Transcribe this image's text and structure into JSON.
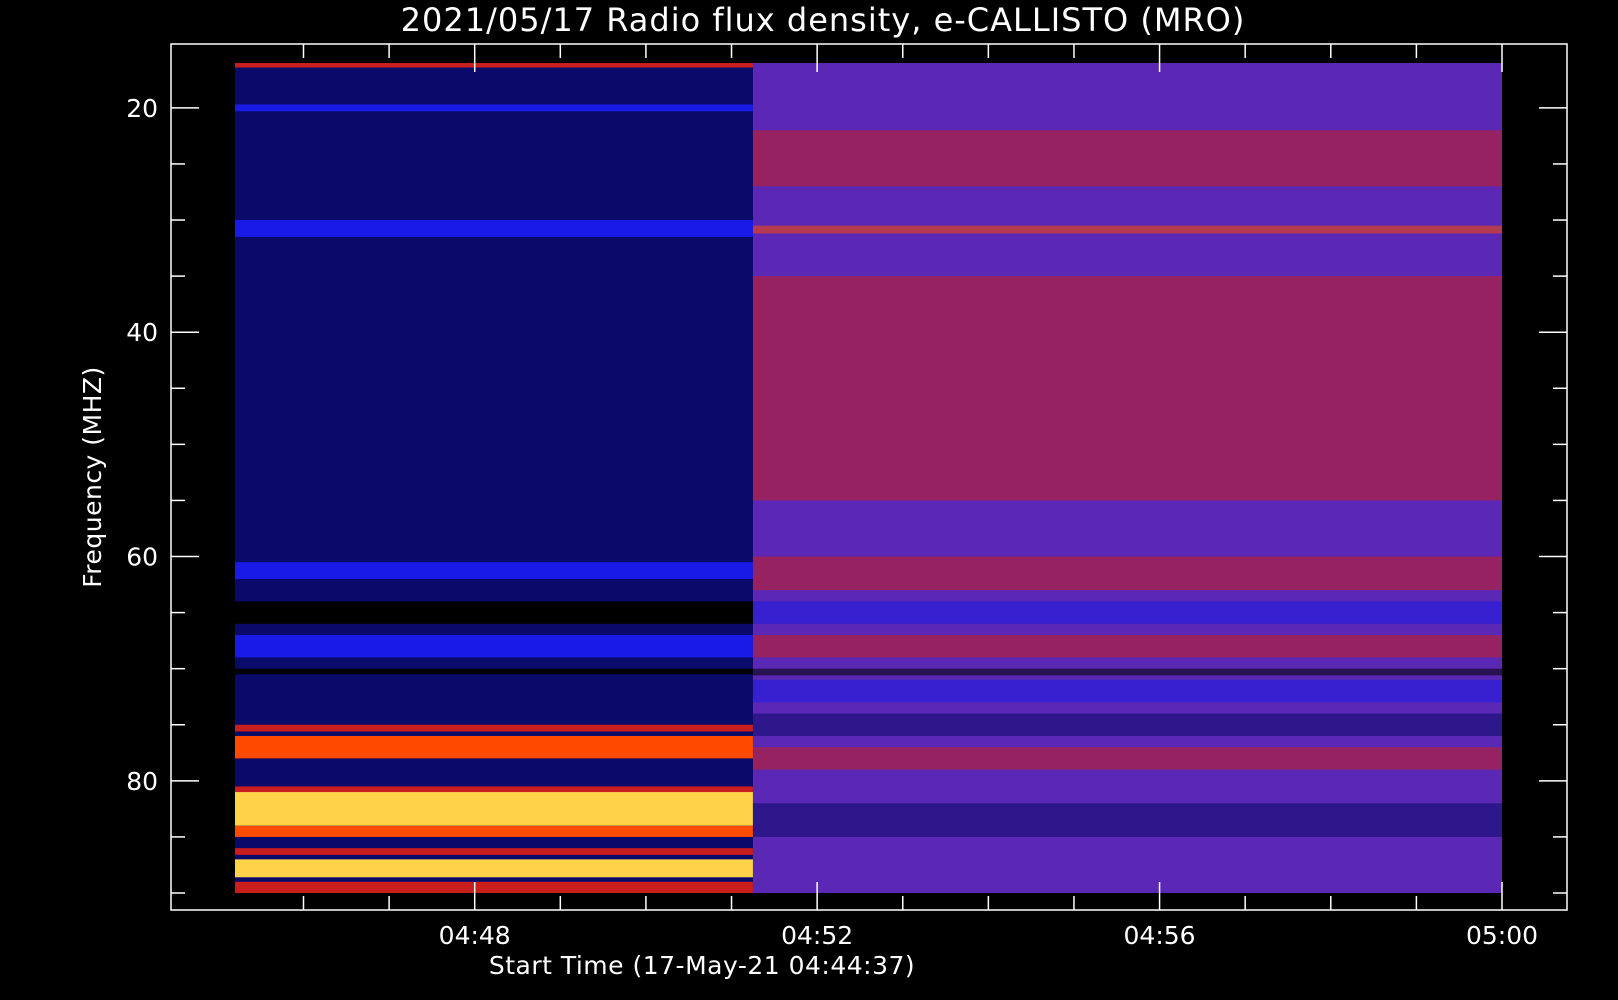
{
  "chart_data": {
    "type": "heatmap",
    "title": "2021/05/17  Radio flux density, e-CALLISTO (MRO)",
    "xlabel": "Start Time (17-May-21 04:44:37)",
    "ylabel": "Frequency (MHZ)",
    "y_inverted": true,
    "x_data_start": "04:45:12",
    "x_data_end": "05:00:00",
    "xlim": [
      "04:44:00",
      "05:03:00"
    ],
    "ylim": [
      90,
      16
    ],
    "y_data_range": [
      16,
      90
    ],
    "x_ticks": [
      "04:48",
      "04:52",
      "04:56",
      "05:00"
    ],
    "y_ticks": [
      20,
      40,
      60,
      80
    ],
    "grid": false,
    "colormap": [
      "#000000",
      "#0a0a6a",
      "#1a1ae6",
      "#5a28b4",
      "#c81e1e",
      "#ff4a00",
      "#ffd24a"
    ],
    "events": [
      {
        "label": "",
        "time": "04:51:15",
        "description": ""
      }
    ]
  }
}
